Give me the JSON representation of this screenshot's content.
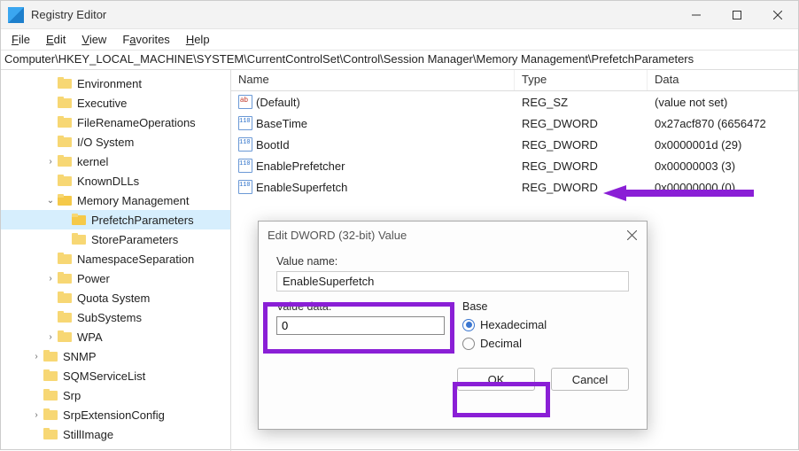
{
  "window": {
    "title": "Registry Editor"
  },
  "menu": {
    "file": "File",
    "edit": "Edit",
    "view": "View",
    "favorites": "Favorites",
    "help": "Help"
  },
  "address": "Computer\\HKEY_LOCAL_MACHINE\\SYSTEM\\CurrentControlSet\\Control\\Session Manager\\Memory Management\\PrefetchParameters",
  "tree": [
    {
      "label": "Environment",
      "indent": 3
    },
    {
      "label": "Executive",
      "indent": 3
    },
    {
      "label": "FileRenameOperations",
      "indent": 3
    },
    {
      "label": "I/O System",
      "indent": 3
    },
    {
      "label": "kernel",
      "indent": 3,
      "expander": ">"
    },
    {
      "label": "KnownDLLs",
      "indent": 3
    },
    {
      "label": "Memory Management",
      "indent": 3,
      "expander": "v",
      "open": true
    },
    {
      "label": "PrefetchParameters",
      "indent": 4,
      "selected": true
    },
    {
      "label": "StoreParameters",
      "indent": 4
    },
    {
      "label": "NamespaceSeparation",
      "indent": 3
    },
    {
      "label": "Power",
      "indent": 3,
      "expander": ">"
    },
    {
      "label": "Quota System",
      "indent": 3
    },
    {
      "label": "SubSystems",
      "indent": 3
    },
    {
      "label": "WPA",
      "indent": 3,
      "expander": ">"
    },
    {
      "label": "SNMP",
      "indent": 2,
      "expander": ">"
    },
    {
      "label": "SQMServiceList",
      "indent": 2
    },
    {
      "label": "Srp",
      "indent": 2
    },
    {
      "label": "SrpExtensionConfig",
      "indent": 2,
      "expander": ">"
    },
    {
      "label": "StillImage",
      "indent": 2
    }
  ],
  "columns": {
    "name": "Name",
    "type": "Type",
    "data": "Data"
  },
  "values": [
    {
      "icon": "str",
      "name": "(Default)",
      "type": "REG_SZ",
      "data": "(value not set)"
    },
    {
      "icon": "dw",
      "name": "BaseTime",
      "type": "REG_DWORD",
      "data": "0x27acf870 (6656472"
    },
    {
      "icon": "dw",
      "name": "BootId",
      "type": "REG_DWORD",
      "data": "0x0000001d (29)"
    },
    {
      "icon": "dw",
      "name": "EnablePrefetcher",
      "type": "REG_DWORD",
      "data": "0x00000003 (3)"
    },
    {
      "icon": "dw",
      "name": "EnableSuperfetch",
      "type": "REG_DWORD",
      "data": "0x00000000 (0)"
    }
  ],
  "dialog": {
    "title": "Edit DWORD (32-bit) Value",
    "value_name_label": "Value name:",
    "value_name": "EnableSuperfetch",
    "value_data_label": "Value data:",
    "value_data": "0",
    "base_label": "Base",
    "hex_label": "Hexadecimal",
    "dec_label": "Decimal",
    "ok": "OK",
    "cancel": "Cancel"
  }
}
